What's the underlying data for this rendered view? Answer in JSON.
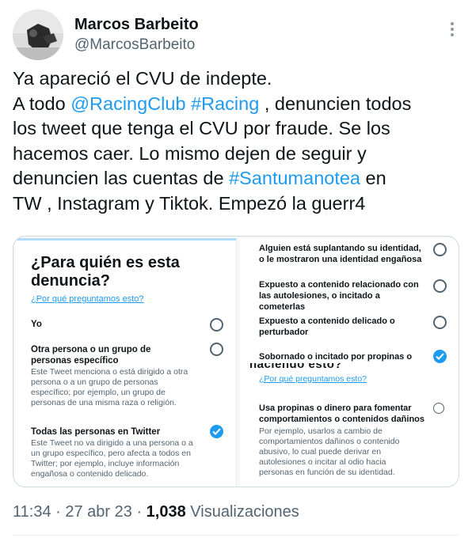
{
  "author": {
    "name": "Marcos Barbeito",
    "handle": "@MarcosBarbeito",
    "avatar_icon": "profile-photo"
  },
  "more_icon": "more-horizontal-icon",
  "tweet": {
    "lines": [
      [
        {
          "text": "Ya apareció el CVU de indepte."
        }
      ],
      [
        {
          "text": "A todo "
        },
        {
          "text": "@RacingClub",
          "link": true
        },
        {
          "text": " "
        },
        {
          "text": "#Racing",
          "link": true
        },
        {
          "text": " , denuncien todos"
        }
      ],
      [
        {
          "text": "los tweet que tenga el CVU por fraude. Se los"
        }
      ],
      [
        {
          "text": "hacemos caer. Lo mismo dejen de seguir y"
        }
      ],
      [
        {
          "text": "denuncien las cuentas de "
        },
        {
          "text": "#Santumanotea",
          "link": true
        },
        {
          "text": " en"
        }
      ],
      [
        {
          "text": "TW , Instagram y Tiktok. Empezó la guerr4"
        }
      ]
    ]
  },
  "media": {
    "left": {
      "title": "¿Para quién es esta denuncia?",
      "why_link": "¿Por qué preguntamos esto?",
      "options": [
        {
          "label": "Yo",
          "desc": "",
          "checked": false
        },
        {
          "label": "Otra persona o un grupo de personas específico",
          "desc": "Este Tweet menciona o está dirigido a otra persona o a un grupo de personas específico; por ejemplo, un grupo de personas de una misma raza o religión.",
          "checked": false
        },
        {
          "label": "Todas las personas en Twitter",
          "desc": "Este Tweet no va dirigido a una persona o a un grupo específico, pero afecta a todos en Twitter; por ejemplo, incluye información engañosa o contenido delicado.",
          "checked": true
        }
      ]
    },
    "top_right": {
      "options": [
        {
          "label": "Alguien está suplantando su identidad, o le mostraron una identidad engañosa",
          "checked": false
        },
        {
          "label": "Expuesto a contenido relacionado con las autolesiones, o incitado a cometerlas",
          "checked": false
        },
        {
          "label": "Expuesto a contenido delicado o perturbador",
          "checked": false
        },
        {
          "label": "Sobornado o incitado por propinas o",
          "checked": true
        }
      ]
    },
    "bottom_right": {
      "cut_title": "naciendo esto?",
      "why_link": "¿Por qué preguntamos esto?",
      "option": {
        "label": "Usa propinas o dinero para fomentar comportamientos o contenidos dañinos",
        "desc": "Por ejemplo, usarlos a cambio de comportamientos dañinos o contenido abusivo, lo cual puede derivar en autolesiones o incitar al odio hacia personas en función de su identidad.",
        "checked": false
      }
    }
  },
  "meta": {
    "time": "11:34",
    "date": "27 abr 23",
    "views_count": "1,038",
    "views_label": "Visualizaciones"
  },
  "colors": {
    "accent": "#1d9bf0",
    "text": "#0f1419",
    "secondary": "#536471"
  }
}
